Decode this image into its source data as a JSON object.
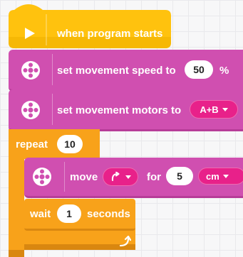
{
  "blocks": {
    "start": {
      "label": "when program starts"
    },
    "speed": {
      "label": "set movement speed to",
      "value": "50",
      "unit": "%"
    },
    "motors": {
      "label": "set movement motors to",
      "value": "A+B"
    },
    "repeat": {
      "label": "repeat",
      "count": "10"
    },
    "move": {
      "label": "move",
      "for_label": "for",
      "amount": "5",
      "unit": "cm"
    },
    "wait": {
      "label": "wait",
      "value": "1",
      "unit": "seconds"
    }
  },
  "colors": {
    "event": "#ffc20e",
    "motor": "#d04fb0",
    "motor_dark": "#b73c98",
    "control": "#f8a21a",
    "control_dark": "#d98710",
    "pill": "#e8218a"
  },
  "icons": {
    "start": "play-icon",
    "motor": "motor-icon",
    "direction": "rotate-clockwise-icon",
    "loop_end": "loop-arrow-icon"
  }
}
